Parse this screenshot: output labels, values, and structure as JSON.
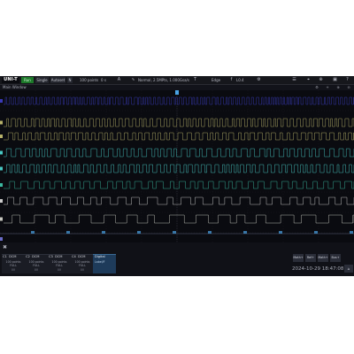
{
  "topbar": {
    "logo": "UNI-T",
    "run_state": "Run",
    "single_label": "Single",
    "autoset_label": "Autoset",
    "mode_label": "N",
    "record": "100 points",
    "timebase": "0 s",
    "acq_label": "A",
    "sample_info": "Normal, 2.5MPts, 1.000Gsa/s",
    "trigger_icon": "T",
    "trigger_type": "Edge",
    "trigger_src_label": "f",
    "trigger_level": "L0.4"
  },
  "titlebar": {
    "title": "Main Window"
  },
  "channels": [
    {
      "name": "C1",
      "coupling": "DCM",
      "points": "100 points",
      "mode": "FULL",
      "offset": "0V"
    },
    {
      "name": "C2",
      "coupling": "DCM",
      "points": "100 points",
      "mode": "FULL",
      "offset": "0V"
    },
    {
      "name": "C3",
      "coupling": "DCM",
      "points": "100 points",
      "mode": "FULL",
      "offset": "0V"
    },
    {
      "name": "C4",
      "coupling": "DCM",
      "points": "100 points",
      "mode": "FULL",
      "offset": "0V"
    }
  ],
  "digital": {
    "label": "Digital",
    "sub": "Label/F"
  },
  "measure_buttons": [
    "Math+",
    "Ref+",
    "Math+",
    "Bus+"
  ],
  "datetime": "2024-10-29 18:47:08",
  "home_label": "⌂",
  "colors": {
    "accent": "#d9a520",
    "run": "#1d7a2a",
    "digital": "#1e3b5a",
    "traces": [
      "#b8b26a",
      "#48c8c4",
      "#3bb8a0",
      "#cccccc",
      "#c8c8c0",
      "#6a6cc8"
    ]
  },
  "icons": {
    "corner": "close-x-icon",
    "menu": "menu-icon",
    "cursor": "cursor-icon",
    "zoom": "zoom-icon"
  }
}
